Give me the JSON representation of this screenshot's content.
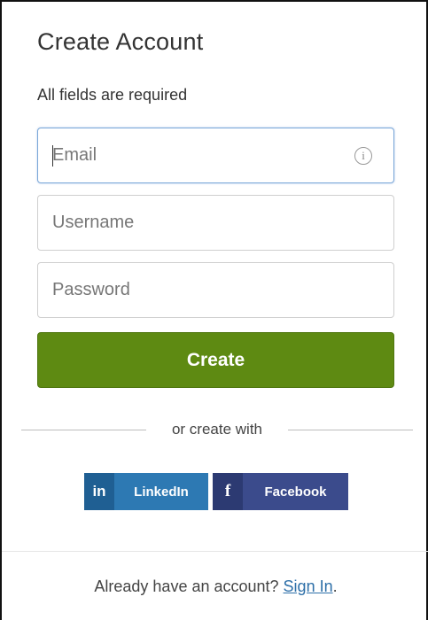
{
  "form": {
    "title": "Create Account",
    "subtitle": "All fields are required",
    "email_placeholder": "Email",
    "username_placeholder": "Username",
    "password_placeholder": "Password",
    "info_symbol": "i",
    "create_label": "Create",
    "divider_text": "or create with"
  },
  "social": {
    "linkedin_logo": "in",
    "linkedin_label": "LinkedIn",
    "facebook_logo": "f",
    "facebook_label": "Facebook"
  },
  "footer": {
    "prompt": "Already have an account?",
    "link_label": "Sign In",
    "trailing": "."
  },
  "colors": {
    "create_button": "#5e8a12",
    "linkedin": "#2d79b3",
    "facebook": "#3b4b8c",
    "link": "#2d6fa8",
    "focus_border": "#7aa7d8"
  },
  "icons": {
    "info": "info-circle-icon",
    "linkedin": "linkedin-logo-icon",
    "facebook": "facebook-logo-icon"
  }
}
